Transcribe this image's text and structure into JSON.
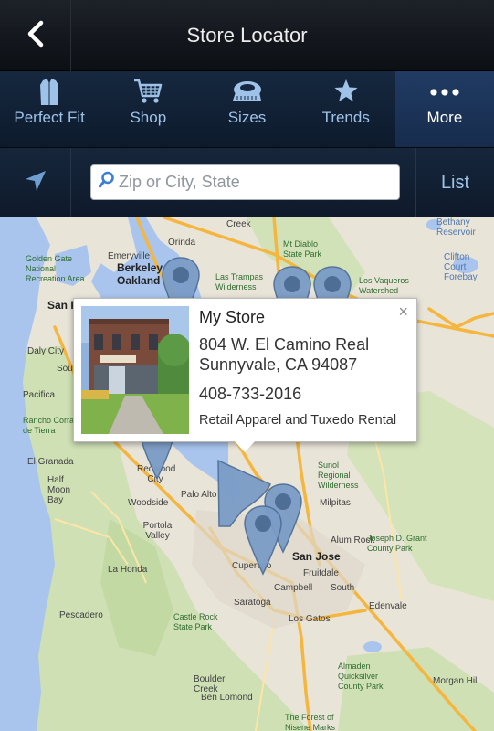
{
  "header": {
    "title": "Store Locator",
    "back_icon": "chevron-left-icon"
  },
  "tabs": [
    {
      "label": "Perfect Fit",
      "icon": "shirt-icon",
      "active": false
    },
    {
      "label": "Shop",
      "icon": "shopping-cart-icon",
      "active": false
    },
    {
      "label": "Sizes",
      "icon": "tape-measure-icon",
      "active": false
    },
    {
      "label": "Trends",
      "icon": "star-icon",
      "active": false
    },
    {
      "label": "More",
      "icon": "more-dots-icon",
      "active": true
    }
  ],
  "search": {
    "placeholder": "Zip or City, State",
    "value": "",
    "locate_icon": "location-arrow-icon",
    "search_icon": "search-icon",
    "list_label": "List"
  },
  "popup": {
    "name": "My Store",
    "address_line1": "804 W. El Camino Real",
    "address_line2": "Sunnyvale, CA 94087",
    "phone": "408-733-2016",
    "description": "Retail Apparel and Tuxedo Rental",
    "close_symbol": "×"
  },
  "map": {
    "labels": {
      "berkeley": "Berkeley",
      "oakland": "Oakland",
      "emeryville": "Emeryville",
      "golden_gate": "Golden Gate National Recreation Area",
      "san_francisco": "San Fran",
      "daly_city": "Daly City",
      "south": "South",
      "pacifica": "Pacifica",
      "rancho_corral": "Rancho Corral de Tierra",
      "el_granada": "El Granada",
      "half_moon_bay": "Half Moon Bay",
      "redwood_city": "Redwood City",
      "woodside": "Woodside",
      "palo_alto": "Palo Alto",
      "portola_valley": "Portola Valley",
      "la_honda": "La Honda",
      "pescadero": "Pescadero",
      "san_jose": "San Jose",
      "milpitas": "Milpitas",
      "cupertino": "Cupertino",
      "campbell": "Campbell",
      "saratoga": "Saratoga",
      "los_gatos": "Los Gatos",
      "fruitdale": "Fruitdale",
      "south_sj": "South",
      "edenvale": "Edenvale",
      "mt_diablo": "Mt Diablo State Park",
      "las_trampas": "Las Trampas Wilderness",
      "los_vaqueros": "Los Vaqueros Watershed",
      "clifton_court": "Clifton Court Forebay",
      "bethany": "Bethany Reservoir",
      "sunol": "Sunol Regional Wilderness",
      "alum_rock": "Alum Rock",
      "joseph_grant": "Joseph D. Grant County Park",
      "castle_rock": "Castle Rock State Park",
      "almaden": "Almaden Quicksilver County Park",
      "boulder_creek": "Boulder Creek",
      "ben_lomond": "Ben Lomond",
      "morgan_hill": "Morgan Hill",
      "forest_nisene": "The Forest of Nisene Marks",
      "creek": "Creek",
      "orinda": "Orinda"
    }
  }
}
